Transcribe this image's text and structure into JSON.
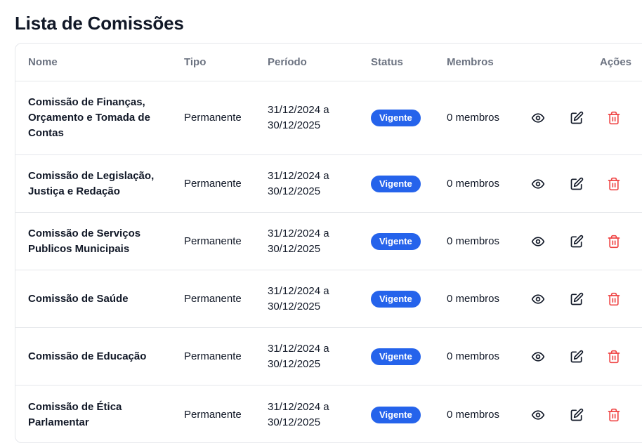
{
  "page_title": "Lista de Comissões",
  "columns": {
    "nome": "Nome",
    "tipo": "Tipo",
    "periodo": "Período",
    "status": "Status",
    "membros": "Membros",
    "acoes": "Ações"
  },
  "rows": [
    {
      "name": "Comissão de Finanças, Orçamento e Tomada de Contas",
      "type": "Permanente",
      "period": "31/12/2024 a 30/12/2025",
      "status": "Vigente",
      "members": "0 membros"
    },
    {
      "name": "Comissão de Legislação, Justiça e Redação",
      "type": "Permanente",
      "period": "31/12/2024 a 30/12/2025",
      "status": "Vigente",
      "members": "0 membros"
    },
    {
      "name": "Comissão de Serviços Publicos Municipais",
      "type": "Permanente",
      "period": "31/12/2024 a 30/12/2025",
      "status": "Vigente",
      "members": "0 membros"
    },
    {
      "name": "Comissão de Saúde",
      "type": "Permanente",
      "period": "31/12/2024 a 30/12/2025",
      "status": "Vigente",
      "members": "0 membros"
    },
    {
      "name": "Comissão de Educação",
      "type": "Permanente",
      "period": "31/12/2024 a 30/12/2025",
      "status": "Vigente",
      "members": "0 membros"
    },
    {
      "name": "Comissão de Ética Parlamentar",
      "type": "Permanente",
      "period": "31/12/2024 a 30/12/2025",
      "status": "Vigente",
      "members": "0 membros"
    }
  ],
  "icons": {
    "view": "eye-icon",
    "edit": "edit-icon",
    "delete": "trash-icon"
  },
  "colors": {
    "badge": "#2563eb",
    "delete": "#ef4444",
    "header_text": "#6b7280"
  }
}
